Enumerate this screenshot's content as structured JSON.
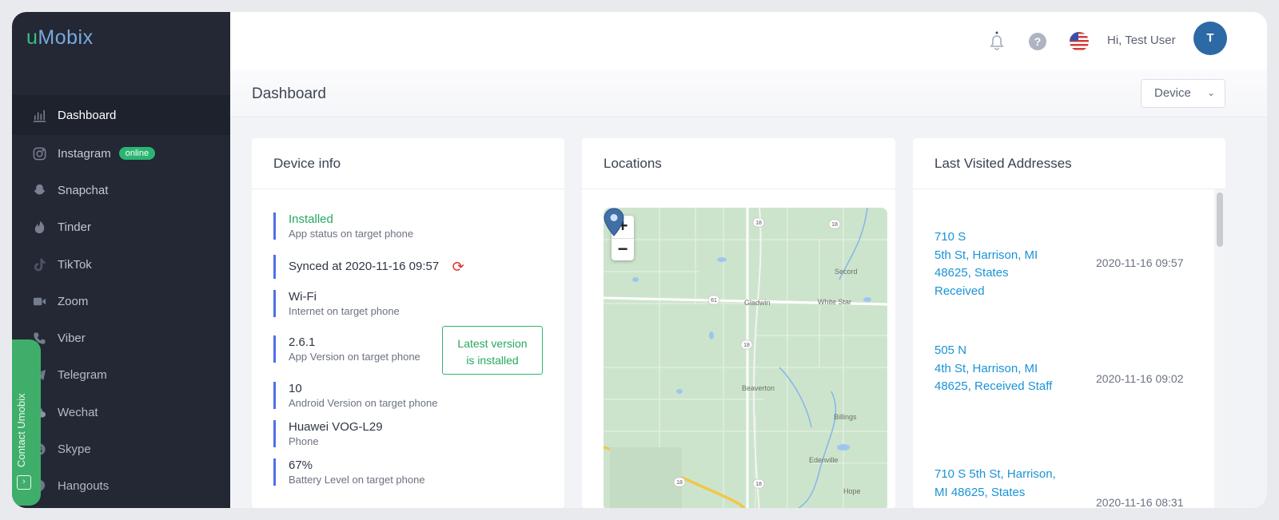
{
  "app": {
    "logo_u": "u",
    "logo_rest": "Mobix"
  },
  "sidebar": {
    "items": [
      {
        "label": "Dashboard",
        "icon": "chart-bars-icon"
      },
      {
        "label": "Instagram",
        "icon": "instagram-icon",
        "badge": "online"
      },
      {
        "label": "Snapchat",
        "icon": "snapchat-icon"
      },
      {
        "label": "Tinder",
        "icon": "flame-icon"
      },
      {
        "label": "TikTok",
        "icon": "tiktok-icon"
      },
      {
        "label": "Zoom",
        "icon": "video-camera-icon"
      },
      {
        "label": "Viber",
        "icon": "phone-icon"
      },
      {
        "label": "Telegram",
        "icon": "paper-plane-icon"
      },
      {
        "label": "Wechat",
        "icon": "chat-bubbles-icon"
      },
      {
        "label": "Skype",
        "icon": "skype-icon"
      },
      {
        "label": "Hangouts",
        "icon": "hangouts-icon"
      }
    ],
    "contact_label": "Contact Umobix"
  },
  "header": {
    "greeting": "Hi, Test User",
    "avatar_initial": "T"
  },
  "page": {
    "title": "Dashboard",
    "device_select": "Device"
  },
  "device_info": {
    "title": "Device info",
    "status": {
      "value": "Installed",
      "label": "App status on target phone"
    },
    "synced": "Synced at 2020-11-16 09:57",
    "internet": {
      "value": "Wi-Fi",
      "label": "Internet on target phone"
    },
    "app_version": {
      "value": "2.6.1",
      "label": "App Version on target phone"
    },
    "latest_badge_1": "Latest version",
    "latest_badge_2": "is installed",
    "android": {
      "value": "10",
      "label": "Android Version on target phone"
    },
    "phone": {
      "value": "Huawei VOG-L29",
      "label": "Phone"
    },
    "battery": {
      "value": "67%",
      "label": "Battery Level on target phone"
    }
  },
  "locations": {
    "title": "Locations",
    "zoom_in": "+",
    "zoom_out": "−",
    "places": [
      "Gladwin",
      "White Star",
      "Secord",
      "Beaverton",
      "Billings",
      "Edenville",
      "Hope"
    ],
    "routes": [
      "18",
      "18",
      "61",
      "18",
      "18",
      "18"
    ]
  },
  "addresses": {
    "title": "Last Visited Addresses",
    "items": [
      {
        "l1": "710 S",
        "l2": "5th St, Harrison, MI",
        "l3": "48625, States",
        "l4": "Received",
        "time": "2020-11-16 09:57"
      },
      {
        "l1": "505 N",
        "l2": "4th St, Harrison, MI",
        "l3": "48625, Received Staff",
        "time": "2020-11-16 09:02"
      },
      {
        "l1": "710 S 5th St, Harrison,",
        "l2": "MI 48625, States",
        "time": "2020-11-16 08:31"
      }
    ]
  }
}
